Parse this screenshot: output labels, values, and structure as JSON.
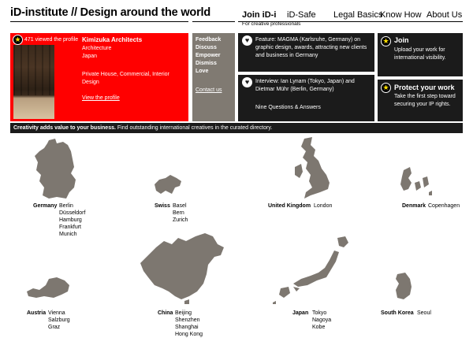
{
  "header": {
    "title": "iD-institute // Design around the world",
    "nav": [
      {
        "label": "Join iD-i"
      },
      {
        "label": "iD-Safe"
      },
      {
        "label": "Legal Basics"
      },
      {
        "label": "Know How"
      },
      {
        "label": "About Us"
      }
    ],
    "nav_sub": "For creative professionals"
  },
  "profile": {
    "views": "471 viewed the profile",
    "name": "Kimizuka Architects",
    "field": "Architecture",
    "country": "Japan",
    "specialties": "Private House, Commercial, Interior Design",
    "link": "View the profile"
  },
  "feedback": {
    "items": [
      "Feedback",
      "Discuss",
      "Empower",
      "Dismiss",
      "Love"
    ],
    "contact": "Contact us"
  },
  "news": [
    {
      "text": "Feature: MAGMA (Karlsruhe, Germany) on graphic design, awards, attracting new clients and business in Germany"
    },
    {
      "text": "Interview: Ian Lynam (Tokyo, Japan) and Dietmar Mühr (Berlin, Germany)",
      "text2": "Nine Questions & Answers"
    }
  ],
  "join": {
    "title": "Join",
    "text": "Upload your work for international visibility."
  },
  "protect": {
    "title": "Protect your work",
    "text": "Take the first step toward securing your IP rights."
  },
  "tagline": {
    "bold": "Creativity adds value to your business.",
    "rest": "Find outstanding international creatives in the curated directory."
  },
  "countries": [
    {
      "name": "Germany",
      "cities": [
        "Berlin",
        "Düsseldorf",
        "Hamburg",
        "Frankfurt",
        "Munich"
      ]
    },
    {
      "name": "Swiss",
      "cities": [
        "Basel",
        "Bern",
        "Zurich"
      ]
    },
    {
      "name": "United Kingdom",
      "cities": [
        "London"
      ]
    },
    {
      "name": "Denmark",
      "cities": [
        "Copenhagen"
      ]
    },
    {
      "name": "Austria",
      "cities": [
        "Vienna",
        "Salzburg",
        "Graz"
      ]
    },
    {
      "name": "China",
      "cities": [
        "Beijing",
        "Shenzhen",
        "Shanghai",
        "Hong Kong"
      ]
    },
    {
      "name": "Japan",
      "cities": [
        "Tokyo",
        "Nagoya",
        "Kobe"
      ]
    },
    {
      "name": "South Korea",
      "cities": [
        "Seoul"
      ]
    }
  ],
  "colors": {
    "accent": "#ff0000",
    "dark": "#1b1b1b",
    "grey": "#807a72",
    "map": "#7d7770",
    "star": "#ffe000"
  }
}
